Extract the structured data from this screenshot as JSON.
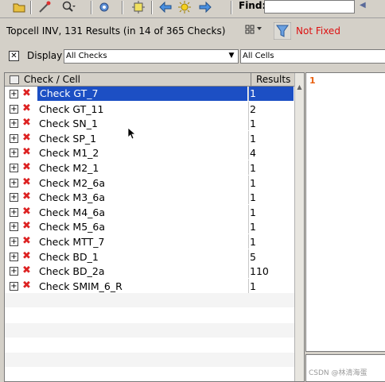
{
  "toolbar": {
    "find_label": "Find:",
    "find_value": ""
  },
  "status": {
    "summary": "Topcell INV, 131 Results (in 14 of 365 Checks)",
    "filter_label": "Not Fixed"
  },
  "display": {
    "label": "Display",
    "checkbox_mark": "✕",
    "checks_value": "All Checks",
    "cells_value": "All Cells"
  },
  "table": {
    "col_check": "Check / Cell",
    "col_results": "Results",
    "rows": [
      {
        "name": "Check GT_7",
        "results": "1"
      },
      {
        "name": "Check GT_11",
        "results": "2"
      },
      {
        "name": "Check SN_1",
        "results": "1"
      },
      {
        "name": "Check SP_1",
        "results": "1"
      },
      {
        "name": "Check M1_2",
        "results": "4"
      },
      {
        "name": "Check M2_1",
        "results": "1"
      },
      {
        "name": "Check M2_6a",
        "results": "1"
      },
      {
        "name": "Check M3_6a",
        "results": "1"
      },
      {
        "name": "Check M4_6a",
        "results": "1"
      },
      {
        "name": "Check M5_6a",
        "results": "1"
      },
      {
        "name": "Check MTT_7",
        "results": "1"
      },
      {
        "name": "Check BD_1",
        "results": "5"
      },
      {
        "name": "Check BD_2a",
        "results": "110"
      },
      {
        "name": "Check SMIM_6_R",
        "results": "1"
      }
    ],
    "selected_index": 0
  },
  "detail": {
    "value": "1"
  },
  "watermark": "CSDN @林清海蛋",
  "colors": {
    "selection": "#1c4fc4",
    "error_mark": "#dd2222",
    "not_fixed": "#dd1111"
  }
}
